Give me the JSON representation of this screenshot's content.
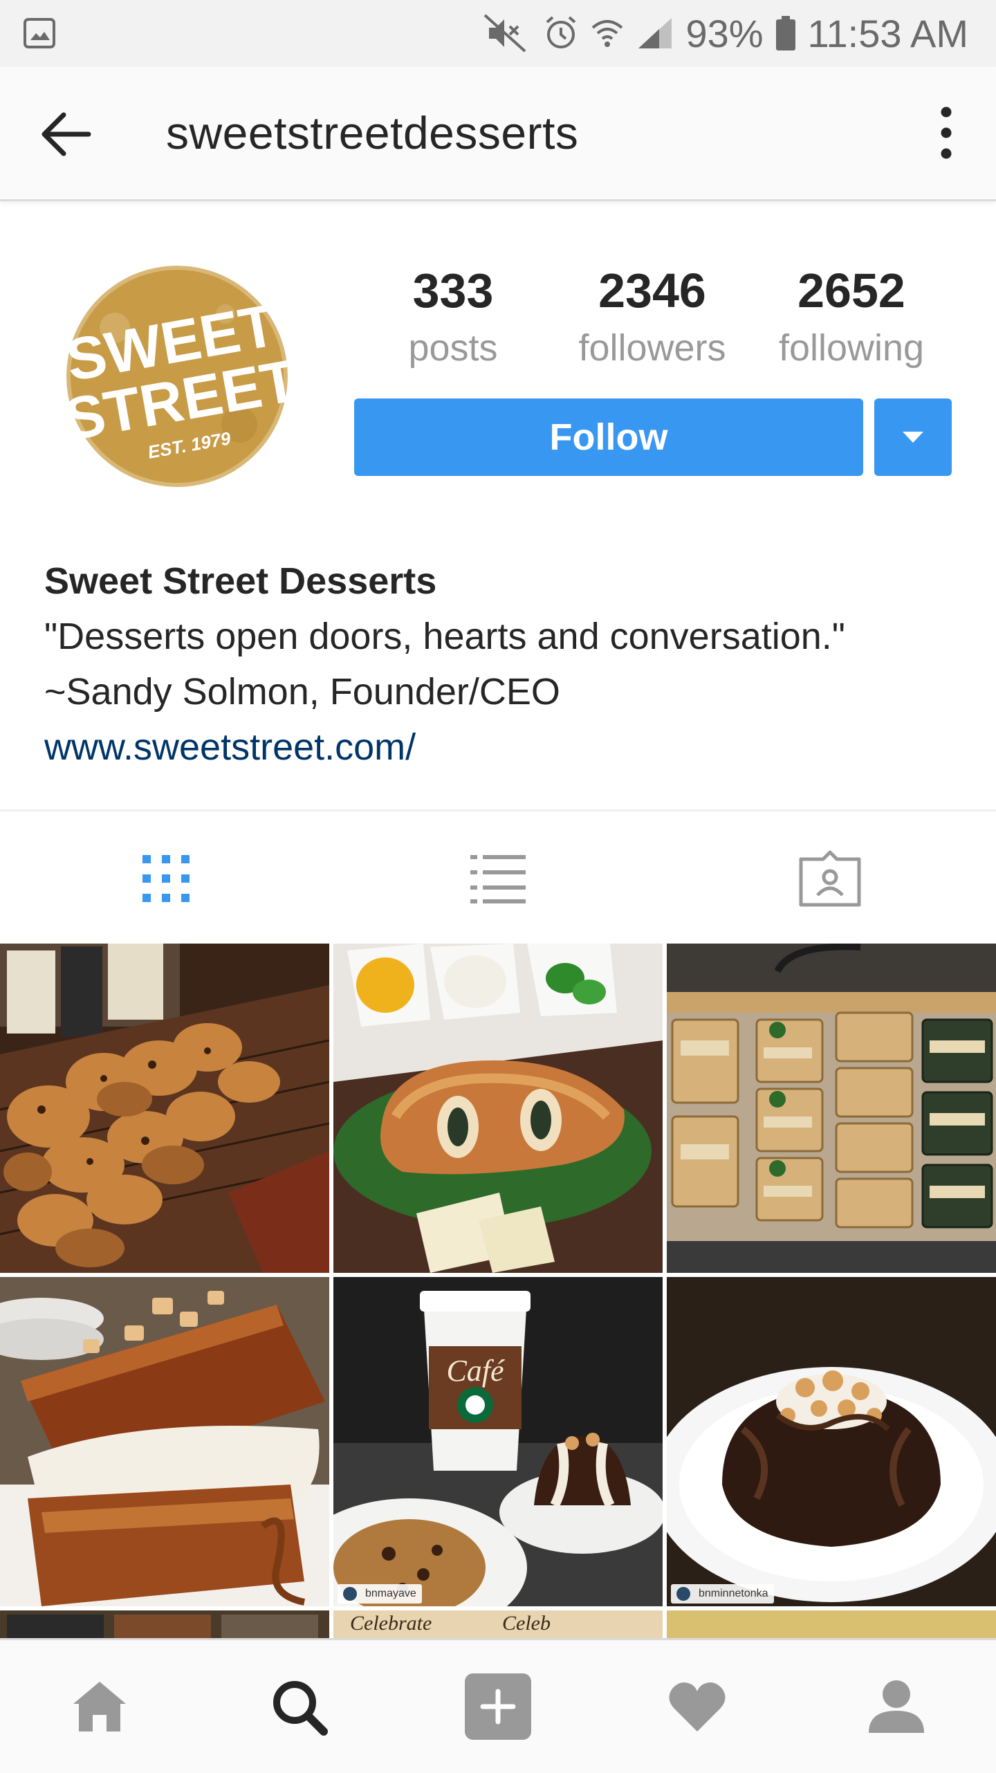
{
  "status_bar": {
    "battery_percent": "93%",
    "time": "11:53 AM",
    "icons": [
      "gallery-icon",
      "mute-icon",
      "alarm-icon",
      "wifi-icon",
      "signal-icon",
      "battery-icon"
    ]
  },
  "header": {
    "username": "sweetstreetdesserts",
    "back_icon": "back-arrow-icon",
    "more_icon": "more-vertical-icon"
  },
  "profile": {
    "avatar_text": {
      "line1": "SWEET",
      "line2": "STREET",
      "line3": "EST. 1979"
    },
    "stats": [
      {
        "count": "333",
        "label": "posts"
      },
      {
        "count": "2346",
        "label": "followers"
      },
      {
        "count": "2652",
        "label": "following"
      }
    ],
    "follow_label": "Follow",
    "bio": {
      "name": "Sweet Street Desserts",
      "line1": "\"Desserts open doors, hearts and conversation.\"",
      "line2": "~Sandy Solmon, Founder/CEO",
      "link": "www.sweetstreet.com/"
    }
  },
  "tabs": [
    {
      "icon": "grid-icon",
      "active": true
    },
    {
      "icon": "list-icon",
      "active": false
    },
    {
      "icon": "tagged-icon",
      "active": false
    }
  ],
  "grid": {
    "tiles": [
      {
        "description": "cookies on tray"
      },
      {
        "description": "pastry sandwich"
      },
      {
        "description": "packaged bars"
      },
      {
        "description": "cake with ice cream"
      },
      {
        "description": "cafe cup with desserts",
        "tag": "bnmayave"
      },
      {
        "description": "chocolate lava cake",
        "tag": "bnminnetonka"
      }
    ],
    "partial_texts": [
      "Celebrate",
      "Celeb"
    ]
  },
  "colors": {
    "accent": "#3897f0",
    "link": "#003569",
    "text": "#262626",
    "muted": "#999999"
  },
  "bottom_nav": [
    {
      "icon": "home-icon"
    },
    {
      "icon": "search-icon",
      "active": true
    },
    {
      "icon": "add-post-icon"
    },
    {
      "icon": "heart-icon"
    },
    {
      "icon": "profile-icon"
    }
  ]
}
